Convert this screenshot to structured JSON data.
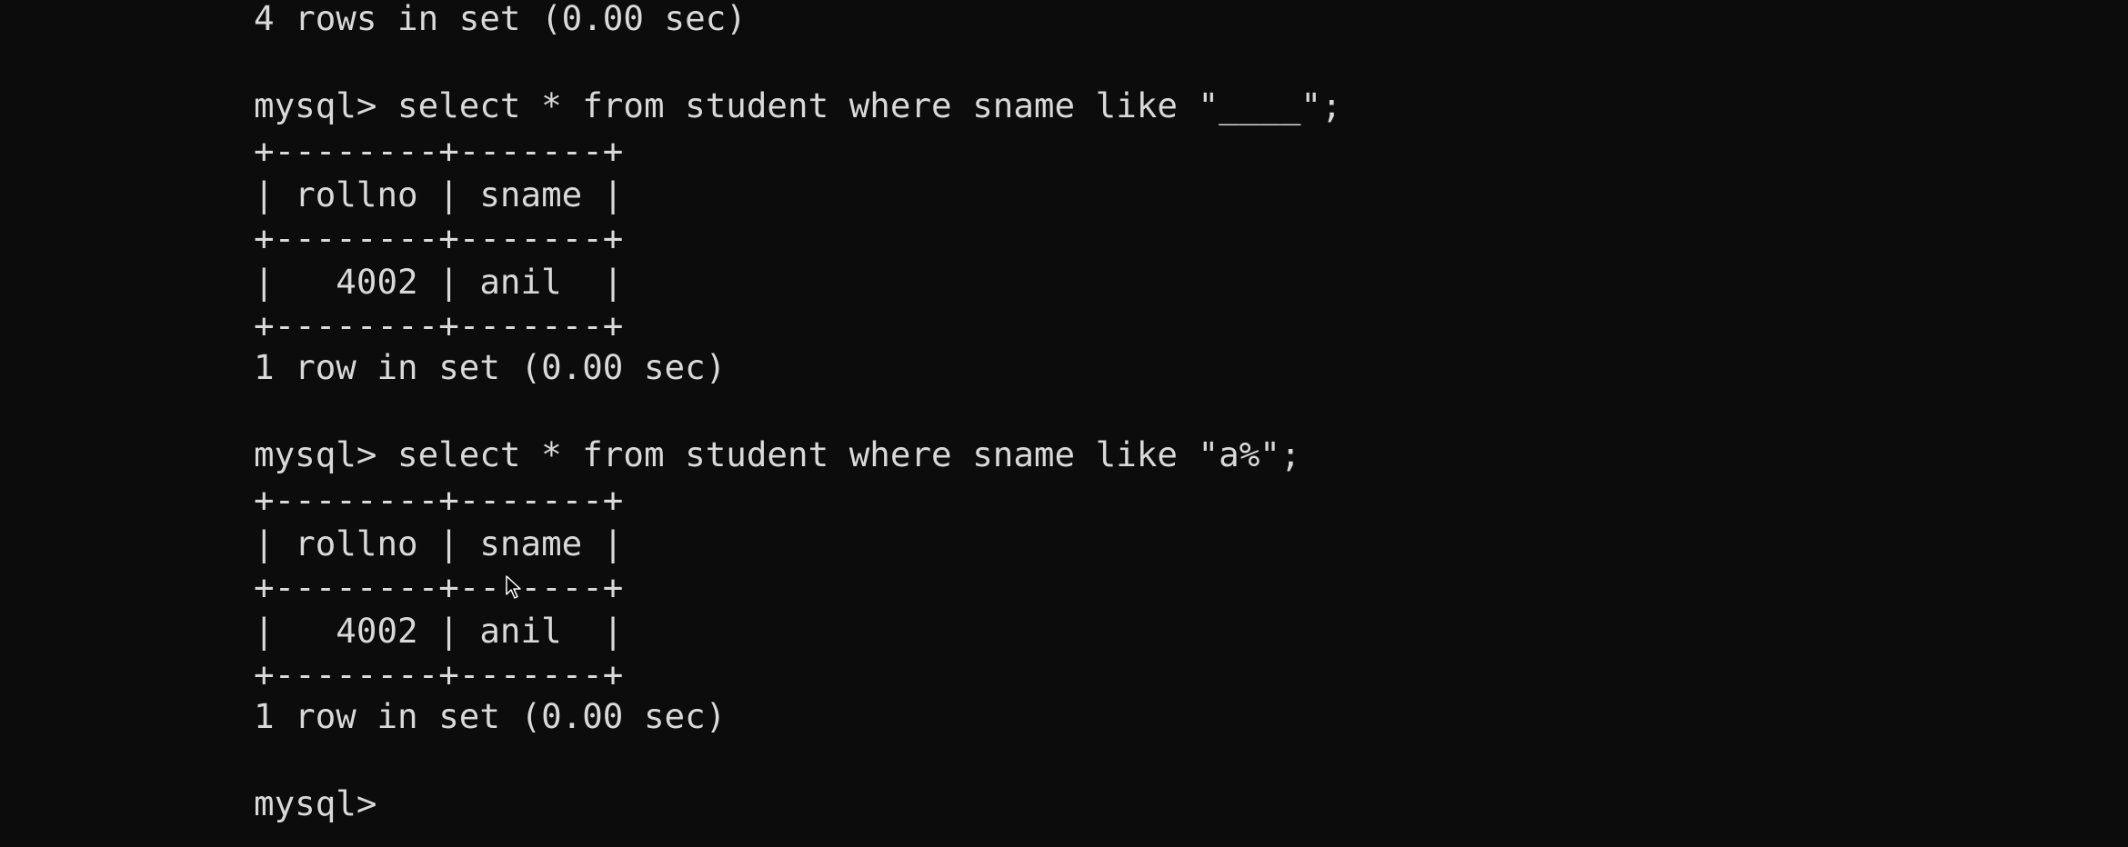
{
  "terminal": {
    "lines": [
      "4 rows in set (0.00 sec)",
      "",
      "mysql> select * from student where sname like \"____\";",
      "+--------+-------+",
      "| rollno | sname |",
      "+--------+-------+",
      "|   4002 | anil  |",
      "+--------+-------+",
      "1 row in set (0.00 sec)",
      "",
      "mysql> select * from student where sname like \"a%\";",
      "+--------+-------+",
      "| rollno | sname |",
      "+--------+-------+",
      "|   4002 | anil  |",
      "+--------+-------+",
      "1 row in set (0.00 sec)",
      "",
      "mysql>"
    ]
  },
  "colors": {
    "background": "#0c0c0c",
    "text": "#d9d9d9"
  },
  "cursor": {
    "icon": "mouse-pointer-icon"
  }
}
